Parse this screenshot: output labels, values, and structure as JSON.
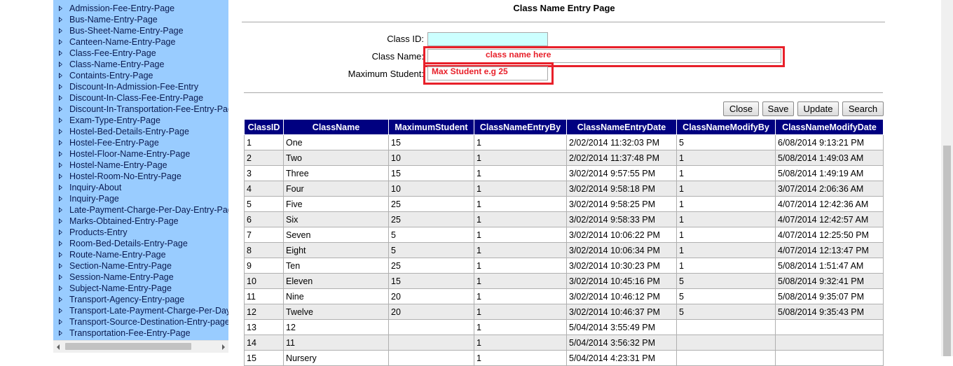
{
  "sidebar": {
    "items": [
      "Admission-Fee-Entry-Page",
      "Bus-Name-Entry-Page",
      "Bus-Sheet-Name-Entry-Page",
      "Canteen-Name-Entry-Page",
      "Class-Fee-Entry-Page",
      "Class-Name-Entry-Page",
      "Containts-Entry-Page",
      "Discount-In-Admission-Fee-Entry",
      "Discount-In-Class-Fee-Entry-Page",
      "Discount-In-Transportation-Fee-Entry-Page",
      "Exam-Type-Entry-Page",
      "Hostel-Bed-Details-Entry-Page",
      "Hostel-Fee-Entry-Page",
      "Hostel-Floor-Name-Entry-Page",
      "Hostel-Name-Entry-Page",
      "Hostel-Room-No-Entry-Page",
      "Inquiry-About",
      "Inquiry-Page",
      "Late-Payment-Charge-Per-Day-Entry-Page",
      "Marks-Obtained-Entry-Page",
      "Products-Entry",
      "Room-Bed-Details-Entry-Page",
      "Route-Name-Entry-Page",
      "Section-Name-Entry-Page",
      "Session-Name-Entry-Page",
      "Subject-Name-Entry-Page",
      "Transport-Agency-Entry-page",
      "Transport-Late-Payment-Charge-Per-Day",
      "Transport-Source-Destination-Entry-page",
      "Transportation-Fee-Entry-Page"
    ]
  },
  "page": {
    "title": "Class Name Entry Page"
  },
  "form": {
    "class_id_label": "Class ID:",
    "class_id_value": "",
    "class_name_label": "Class Name:",
    "class_name_value": "",
    "max_student_label": "Maximum Student:",
    "max_student_value": "",
    "annotation_class_name": "class name here",
    "annotation_max_student": "Max Student e.g 25",
    "annotation_color": "#e8202a"
  },
  "buttons": {
    "close": "Close",
    "save": "Save",
    "update": "Update",
    "search": "Search"
  },
  "grid": {
    "header_color": "#000080",
    "columns": [
      "ClassID",
      "ClassName",
      "MaximumStudent",
      "ClassNameEntryBy",
      "ClassNameEntryDate",
      "ClassNameModifyBy",
      "ClassNameModifyDate"
    ],
    "rows": [
      [
        "1",
        "One",
        "15",
        "1",
        "2/02/2014 11:32:03 PM",
        "5",
        "6/08/2014 9:13:21 PM"
      ],
      [
        "2",
        "Two",
        "10",
        "1",
        "2/02/2014 11:37:48 PM",
        "1",
        "5/08/2014 1:49:03 AM"
      ],
      [
        "3",
        "Three",
        "15",
        "1",
        "3/02/2014 9:57:55 PM",
        "1",
        "5/08/2014 1:49:19 AM"
      ],
      [
        "4",
        "Four",
        "10",
        "1",
        "3/02/2014 9:58:18 PM",
        "1",
        "3/07/2014 2:06:36 AM"
      ],
      [
        "5",
        "Five",
        "25",
        "1",
        "3/02/2014 9:58:25 PM",
        "1",
        "4/07/2014 12:42:36 AM"
      ],
      [
        "6",
        "Six",
        "25",
        "1",
        "3/02/2014 9:58:33 PM",
        "1",
        "4/07/2014 12:42:57 AM"
      ],
      [
        "7",
        "Seven",
        "5",
        "1",
        "3/02/2014 10:06:22 PM",
        "1",
        "4/07/2014 12:25:50 PM"
      ],
      [
        "8",
        "Eight",
        "5",
        "1",
        "3/02/2014 10:06:34 PM",
        "1",
        "4/07/2014 12:13:47 PM"
      ],
      [
        "9",
        "Ten",
        "25",
        "1",
        "3/02/2014 10:30:23 PM",
        "1",
        "5/08/2014 1:51:47 AM"
      ],
      [
        "10",
        "Eleven",
        "15",
        "1",
        "3/02/2014 10:45:16 PM",
        "5",
        "5/08/2014 9:32:41 PM"
      ],
      [
        "11",
        "Nine",
        "20",
        "1",
        "3/02/2014 10:46:12 PM",
        "5",
        "5/08/2014 9:35:07 PM"
      ],
      [
        "12",
        "Twelve",
        "20",
        "1",
        "3/02/2014 10:46:37 PM",
        "5",
        "5/08/2014 9:35:43 PM"
      ],
      [
        "13",
        "12",
        "",
        "1",
        "5/04/2014 3:55:49 PM",
        "",
        ""
      ],
      [
        "14",
        "11",
        "",
        "1",
        "5/04/2014 3:56:32 PM",
        "",
        ""
      ],
      [
        "15",
        "Nursery",
        "",
        "1",
        "5/04/2014 4:23:31 PM",
        "",
        ""
      ]
    ]
  }
}
